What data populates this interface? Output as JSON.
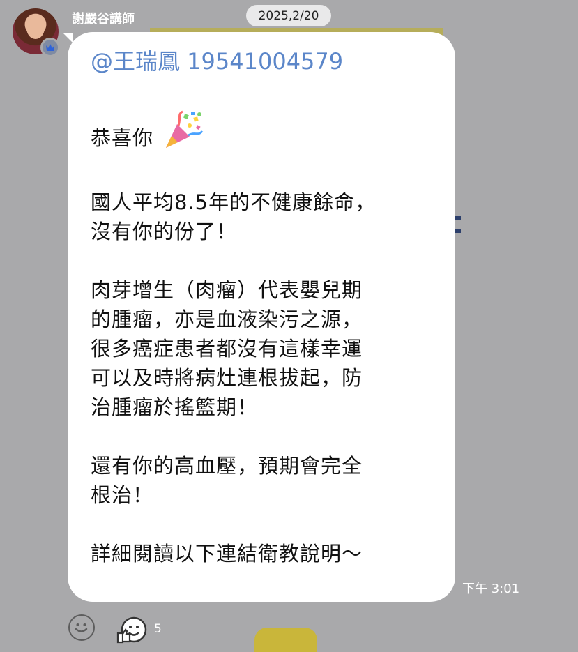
{
  "chat": {
    "sender_name": "謝嚴谷講師",
    "date_label": "2025,2/20",
    "message": {
      "mention": "@王瑞鳳 19541004579",
      "greeting": "恭喜你",
      "paragraphs": [
        [
          "國人平均8.5年的不健康餘命，",
          "沒有你的份了！"
        ],
        [
          "肉芽增生（肉瘤）代表嬰兒期",
          "的腫瘤，亦是血液染污之源，",
          "很多癌症患者都沒有這樣幸運",
          "可以及時將病灶連根拔起，防",
          "治腫瘤於搖籃期！"
        ],
        [
          "還有你的高血壓，預期會完全",
          "根治！"
        ],
        [
          "詳細閱讀以下連結衛教說明～"
        ]
      ],
      "time": "下午 3:01"
    },
    "reactions": {
      "add_icon": "smiley-outline-icon",
      "reaction_icon": "thumbs-up-face-icon",
      "count": "5"
    },
    "badge_icon": "crown-icon",
    "greeting_icon": "party-popper-icon"
  }
}
